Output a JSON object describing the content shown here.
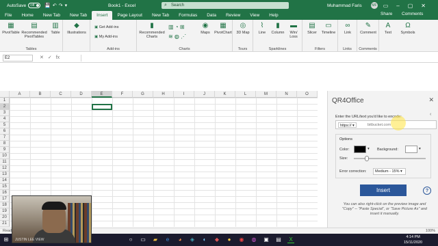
{
  "titlebar": {
    "autosave_label": "AutoSave",
    "autosave_state": "Off",
    "doc_title": "Book1 - Excel",
    "search_placeholder": "Search",
    "user_name": "Muhammad Faris",
    "user_initials": "MF"
  },
  "tabs": [
    "File",
    "Home",
    "New Tab",
    "New Tab",
    "Insert",
    "Page Layout",
    "New Tab",
    "Formulas",
    "Data",
    "Review",
    "View",
    "Help"
  ],
  "active_tab_index": 4,
  "share_label": "Share",
  "comments_label": "Comments",
  "ribbon": {
    "tables": {
      "label": "Tables",
      "buttons": [
        "PivotTable",
        "Recommended PivotTables",
        "Table"
      ]
    },
    "illustrations": {
      "button": "Illustrations"
    },
    "addins": {
      "label": "Add-ins",
      "get": "Get Add-ins",
      "my": "My Add-ins"
    },
    "charts": {
      "label": "Charts",
      "buttons": [
        "Recommended Charts",
        "Maps",
        "PivotChart"
      ]
    },
    "tours": {
      "label": "Tours",
      "button": "3D Map"
    },
    "sparklines": {
      "label": "Sparklines",
      "buttons": [
        "Line",
        "Column",
        "Win/ Loss"
      ]
    },
    "filters": {
      "label": "Filters",
      "buttons": [
        "Slicer",
        "Timeline"
      ]
    },
    "links": {
      "label": "Links",
      "button": "Link"
    },
    "comments": {
      "label": "Comments",
      "button": "Comment"
    },
    "text": {
      "button": "Text"
    },
    "symbols": {
      "button": "Symbols"
    }
  },
  "formula_bar": {
    "name_box": "E2",
    "fx": "fx"
  },
  "grid": {
    "columns": [
      "A",
      "B",
      "C",
      "D",
      "E",
      "F",
      "G",
      "H",
      "I",
      "J",
      "K",
      "L",
      "M",
      "N",
      "O"
    ],
    "rows": [
      "1",
      "2",
      "3",
      "4",
      "5",
      "6",
      "7",
      "8",
      "9",
      "10",
      "11",
      "12",
      "13",
      "14",
      "15",
      "16",
      "17",
      "18",
      "19",
      "20",
      "21"
    ],
    "selected_cell": "E2"
  },
  "pane": {
    "title": "QR4Office",
    "prompt": "Enter the URL/text you'd like to encode:",
    "protocol": "https://",
    "url_value": "bitbucket.com",
    "options_legend": "Options",
    "color_label": "Color:",
    "color_value": "#000000",
    "background_label": "Background:",
    "background_value": "#ffffff",
    "size_label": "Size:",
    "size_fraction": 0.15,
    "error_label": "Error correction:",
    "error_value": "Medium - 15%",
    "insert_label": "Insert",
    "hint": "You can also right-click on the preview image and \"Copy\" -- \"Paste Special\", or \"Save Picture As\" and insert it manually."
  },
  "statusbar": {
    "ready": "Ready",
    "zoom": "100%"
  },
  "taskbar": {
    "time": "4:14 PM",
    "date": "15/11/2020"
  },
  "webcam_caption": "JUSTIN LEE VIEW"
}
